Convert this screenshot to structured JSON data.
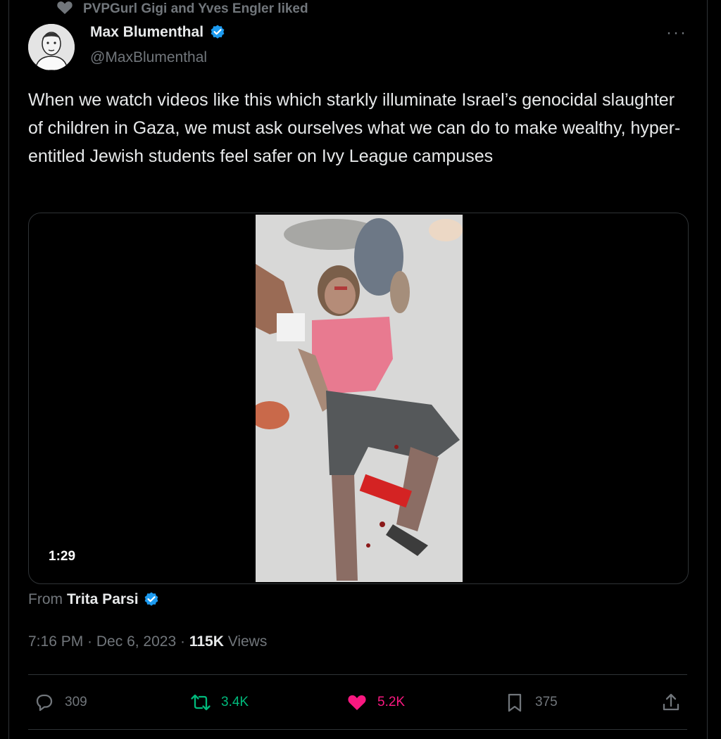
{
  "social_context": {
    "text": "PVPGurl Gigi and Yves Engler liked",
    "icon": "heart-icon"
  },
  "author": {
    "name": "Max Blumenthal",
    "handle": "@MaxBlumenthal",
    "verified": true,
    "avatar_icon": "person-avatar"
  },
  "more_label": "···",
  "tweet": {
    "text": "When we watch videos like this which starkly illuminate Israel’s genocidal slaughter of children in Gaza, we must ask ourselves what we can do to make wealthy, hyper-entitled Jewish students feel safer on Ivy League campuses"
  },
  "media": {
    "duration": "1:29"
  },
  "attribution": {
    "prefix": "From",
    "name": "Trita Parsi",
    "verified": true
  },
  "meta": {
    "time": "7:16 PM",
    "sep1": " · ",
    "date": "Dec 6, 2023",
    "sep2": " · ",
    "views_count": "115K",
    "views_label": " Views"
  },
  "actions": {
    "replies": "309",
    "retweets": "3.4K",
    "likes": "5.2K",
    "bookmarks": "375"
  },
  "colors": {
    "background": "#000000",
    "text": "#e7e9ea",
    "muted": "#71767b",
    "verified": "#1d9bf0",
    "retweet": "#00ba7c",
    "like": "#f91880",
    "border": "#2f3336"
  }
}
